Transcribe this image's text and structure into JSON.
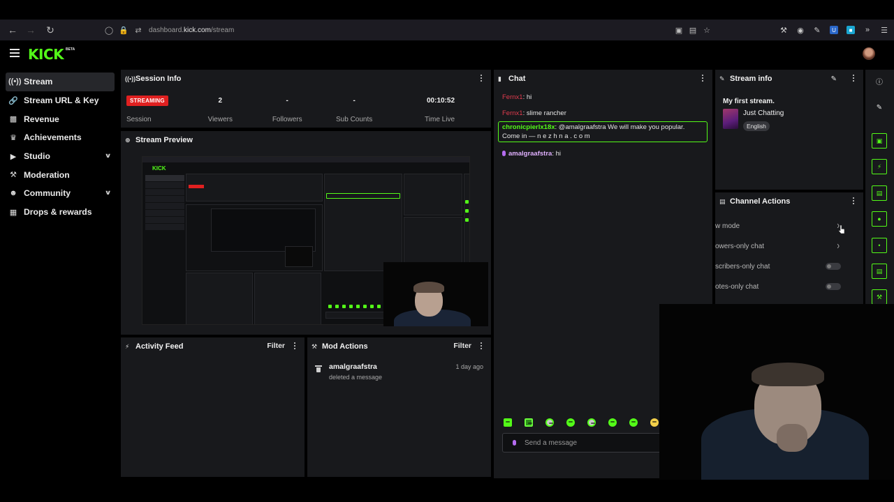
{
  "browser": {
    "url_prefix": "dashboard.",
    "url_domain": "kick.com",
    "url_path": "/stream"
  },
  "app": {
    "logo": "KICK",
    "logo_badge": "BETA"
  },
  "sidebar": {
    "items": [
      {
        "label": "Stream",
        "icon": "broadcast-icon",
        "active": true
      },
      {
        "label": "Stream URL & Key",
        "icon": "link-icon"
      },
      {
        "label": "Revenue",
        "icon": "chart-icon"
      },
      {
        "label": "Achievements",
        "icon": "trophy-icon"
      },
      {
        "label": "Studio",
        "icon": "studio-icon",
        "expandable": true
      },
      {
        "label": "Moderation",
        "icon": "hammer-icon"
      },
      {
        "label": "Community",
        "icon": "people-icon",
        "expandable": true
      },
      {
        "label": "Drops & rewards",
        "icon": "gift-icon"
      }
    ]
  },
  "session_info": {
    "title": "Session Info",
    "status_badge": "STREAMING",
    "stats": [
      {
        "value": "",
        "label": "Session"
      },
      {
        "value": "2",
        "label": "Viewers"
      },
      {
        "value": "-",
        "label": "Followers"
      },
      {
        "value": "-",
        "label": "Sub Counts"
      },
      {
        "value": "00:10:52",
        "label": "Time Live"
      }
    ]
  },
  "stream_preview": {
    "title": "Stream Preview"
  },
  "activity_feed": {
    "title": "Activity Feed",
    "filter_label": "Filter"
  },
  "mod_actions": {
    "title": "Mod Actions",
    "filter_label": "Filter",
    "items": [
      {
        "user": "amalgraafstra",
        "action": "deleted a message",
        "time": "1 day ago"
      }
    ]
  },
  "chat": {
    "title": "Chat",
    "messages": [
      {
        "user": "Fernx1",
        "text": ": hi",
        "style": "red"
      },
      {
        "user": "Fernx1",
        "text": ": slime rancher",
        "style": "red"
      },
      {
        "user": "chronicpierlx18x",
        "text": ": @amalgraafstra We will make you popular. Come in — n e z h n a . c o m",
        "style": "green",
        "highlighted": true
      },
      {
        "user": "amalgraafstra",
        "text": ": hi",
        "style": "purple",
        "mic": true
      }
    ],
    "input_placeholder": "Send a message"
  },
  "stream_info": {
    "title": "Stream info",
    "stream_title": "My first stream.",
    "category": "Just Chatting",
    "language": "English"
  },
  "channel_actions": {
    "title": "Channel Actions",
    "rows": [
      {
        "label": "w mode",
        "control": "chevron"
      },
      {
        "label": "owers-only chat",
        "control": "chevron"
      },
      {
        "label": "scribers-only chat",
        "control": "toggle"
      },
      {
        "label": "otes-only chat",
        "control": "toggle"
      }
    ]
  },
  "toolbar": {
    "buttons": [
      "info-icon",
      "pencil-icon",
      "target-icon",
      "lightning-icon",
      "document-icon",
      "chat-bubble-icon",
      "broadcast-icon",
      "layout-icon",
      "wrench-icon"
    ]
  },
  "colors": {
    "accent": "#53fc18",
    "live_red": "#e02020",
    "panel_bg": "#18191c",
    "page_bg": "#000000"
  }
}
